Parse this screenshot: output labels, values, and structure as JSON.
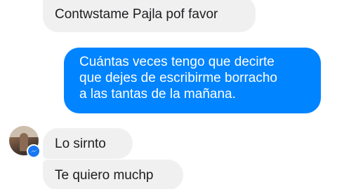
{
  "conversation": {
    "messages": [
      {
        "direction": "received",
        "text": "Contwstame Pajla pof favor"
      },
      {
        "direction": "sent",
        "lines": [
          "Cuántas veces tengo que decirte",
          "que dejes de escribirme borracho",
          "a las tantas de la mañana."
        ]
      },
      {
        "direction": "received",
        "text": "Lo sirnto"
      },
      {
        "direction": "received",
        "text": "Te quiero muchp"
      }
    ]
  },
  "colors": {
    "sent_bubble": "#0084ff",
    "received_bubble": "#f1f0f0",
    "messenger_badge": "#1877f2"
  },
  "icons": {
    "avatar": "contact-avatar",
    "badge": "messenger-icon"
  }
}
